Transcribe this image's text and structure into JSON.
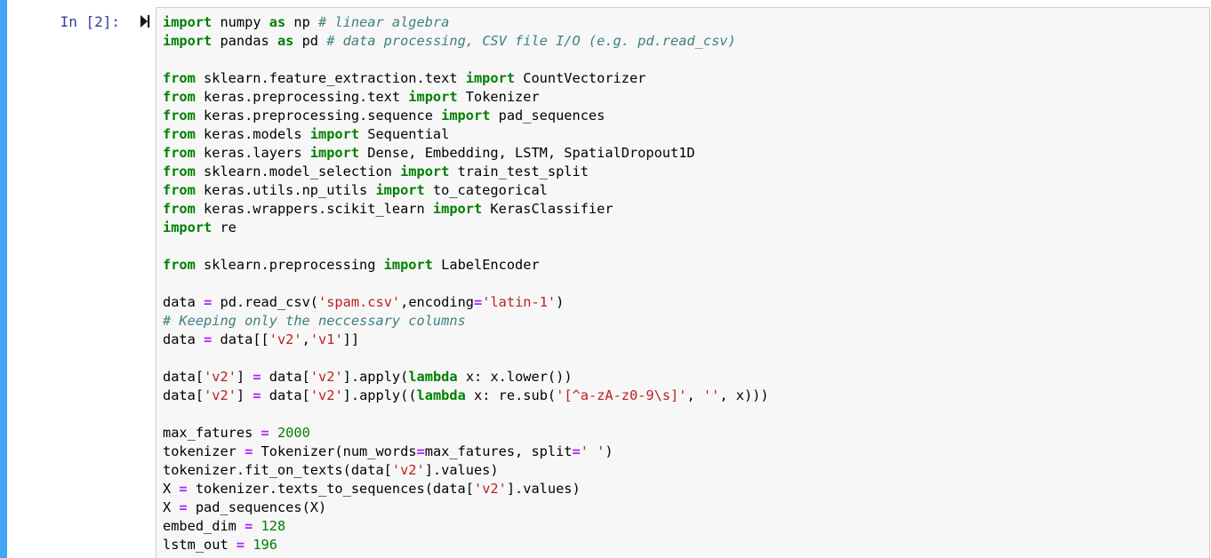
{
  "cell": {
    "prompt": "In [2]:",
    "run_icon": "run-cell-icon"
  },
  "colors": {
    "selected_bar": "#42a5f5",
    "prompt": "#303f9f",
    "keyword": "#008000",
    "comment": "#408080",
    "string": "#ba2121",
    "operator": "#aa22ff",
    "cell_background": "#f7f7f7"
  },
  "code_lines": [
    [
      {
        "t": "kw",
        "v": "import"
      },
      {
        "t": "p",
        "v": " numpy "
      },
      {
        "t": "kw",
        "v": "as"
      },
      {
        "t": "p",
        "v": " np "
      },
      {
        "t": "cm",
        "v": "# linear algebra"
      }
    ],
    [
      {
        "t": "kw",
        "v": "import"
      },
      {
        "t": "p",
        "v": " pandas "
      },
      {
        "t": "kw",
        "v": "as"
      },
      {
        "t": "p",
        "v": " pd "
      },
      {
        "t": "cm",
        "v": "# data processing, CSV file I/O (e.g. pd.read_csv)"
      }
    ],
    [],
    [
      {
        "t": "kw",
        "v": "from"
      },
      {
        "t": "p",
        "v": " sklearn.feature_extraction.text "
      },
      {
        "t": "kw",
        "v": "import"
      },
      {
        "t": "p",
        "v": " CountVectorizer"
      }
    ],
    [
      {
        "t": "kw",
        "v": "from"
      },
      {
        "t": "p",
        "v": " keras.preprocessing.text "
      },
      {
        "t": "kw",
        "v": "import"
      },
      {
        "t": "p",
        "v": " Tokenizer"
      }
    ],
    [
      {
        "t": "kw",
        "v": "from"
      },
      {
        "t": "p",
        "v": " keras.preprocessing.sequence "
      },
      {
        "t": "kw",
        "v": "import"
      },
      {
        "t": "p",
        "v": " pad_sequences"
      }
    ],
    [
      {
        "t": "kw",
        "v": "from"
      },
      {
        "t": "p",
        "v": " keras.models "
      },
      {
        "t": "kw",
        "v": "import"
      },
      {
        "t": "p",
        "v": " Sequential"
      }
    ],
    [
      {
        "t": "kw",
        "v": "from"
      },
      {
        "t": "p",
        "v": " keras.layers "
      },
      {
        "t": "kw",
        "v": "import"
      },
      {
        "t": "p",
        "v": " Dense, Embedding, LSTM, SpatialDropout1D"
      }
    ],
    [
      {
        "t": "kw",
        "v": "from"
      },
      {
        "t": "p",
        "v": " sklearn.model_selection "
      },
      {
        "t": "kw",
        "v": "import"
      },
      {
        "t": "p",
        "v": " train_test_split"
      }
    ],
    [
      {
        "t": "kw",
        "v": "from"
      },
      {
        "t": "p",
        "v": " keras.utils.np_utils "
      },
      {
        "t": "kw",
        "v": "import"
      },
      {
        "t": "p",
        "v": " to_categorical"
      }
    ],
    [
      {
        "t": "kw",
        "v": "from"
      },
      {
        "t": "p",
        "v": " keras.wrappers.scikit_learn "
      },
      {
        "t": "kw",
        "v": "import"
      },
      {
        "t": "p",
        "v": " KerasClassifier"
      }
    ],
    [
      {
        "t": "kw",
        "v": "import"
      },
      {
        "t": "p",
        "v": " re"
      }
    ],
    [],
    [
      {
        "t": "kw",
        "v": "from"
      },
      {
        "t": "p",
        "v": " sklearn.preprocessing "
      },
      {
        "t": "kw",
        "v": "import"
      },
      {
        "t": "p",
        "v": " LabelEncoder"
      }
    ],
    [],
    [
      {
        "t": "p",
        "v": "data "
      },
      {
        "t": "op",
        "v": "="
      },
      {
        "t": "p",
        "v": " pd.read_csv("
      },
      {
        "t": "st",
        "v": "'spam.csv'"
      },
      {
        "t": "p",
        "v": ",encoding"
      },
      {
        "t": "op",
        "v": "="
      },
      {
        "t": "st",
        "v": "'latin-1'"
      },
      {
        "t": "p",
        "v": ")"
      }
    ],
    [
      {
        "t": "cm",
        "v": "# Keeping only the neccessary columns"
      }
    ],
    [
      {
        "t": "p",
        "v": "data "
      },
      {
        "t": "op",
        "v": "="
      },
      {
        "t": "p",
        "v": " data[["
      },
      {
        "t": "st",
        "v": "'v2'"
      },
      {
        "t": "p",
        "v": ","
      },
      {
        "t": "st",
        "v": "'v1'"
      },
      {
        "t": "p",
        "v": "]]"
      }
    ],
    [],
    [
      {
        "t": "p",
        "v": "data["
      },
      {
        "t": "st",
        "v": "'v2'"
      },
      {
        "t": "p",
        "v": "] "
      },
      {
        "t": "op",
        "v": "="
      },
      {
        "t": "p",
        "v": " data["
      },
      {
        "t": "st",
        "v": "'v2'"
      },
      {
        "t": "p",
        "v": "].apply("
      },
      {
        "t": "kw",
        "v": "lambda"
      },
      {
        "t": "p",
        "v": " x: x.lower())"
      }
    ],
    [
      {
        "t": "p",
        "v": "data["
      },
      {
        "t": "st",
        "v": "'v2'"
      },
      {
        "t": "p",
        "v": "] "
      },
      {
        "t": "op",
        "v": "="
      },
      {
        "t": "p",
        "v": " data["
      },
      {
        "t": "st",
        "v": "'v2'"
      },
      {
        "t": "p",
        "v": "].apply(("
      },
      {
        "t": "kw",
        "v": "lambda"
      },
      {
        "t": "p",
        "v": " x: re.sub("
      },
      {
        "t": "st",
        "v": "'[^a-zA-z0-9\\s]'"
      },
      {
        "t": "p",
        "v": ", "
      },
      {
        "t": "st",
        "v": "''"
      },
      {
        "t": "p",
        "v": ", x)))"
      }
    ],
    [],
    [
      {
        "t": "p",
        "v": "max_fatures "
      },
      {
        "t": "op",
        "v": "="
      },
      {
        "t": "p",
        "v": " "
      },
      {
        "t": "nu",
        "v": "2000"
      }
    ],
    [
      {
        "t": "p",
        "v": "tokenizer "
      },
      {
        "t": "op",
        "v": "="
      },
      {
        "t": "p",
        "v": " Tokenizer(num_words"
      },
      {
        "t": "op",
        "v": "="
      },
      {
        "t": "p",
        "v": "max_fatures, split"
      },
      {
        "t": "op",
        "v": "="
      },
      {
        "t": "st",
        "v": "' '"
      },
      {
        "t": "p",
        "v": ")"
      }
    ],
    [
      {
        "t": "p",
        "v": "tokenizer.fit_on_texts(data["
      },
      {
        "t": "st",
        "v": "'v2'"
      },
      {
        "t": "p",
        "v": "].values)"
      }
    ],
    [
      {
        "t": "p",
        "v": "X "
      },
      {
        "t": "op",
        "v": "="
      },
      {
        "t": "p",
        "v": " tokenizer.texts_to_sequences(data["
      },
      {
        "t": "st",
        "v": "'v2'"
      },
      {
        "t": "p",
        "v": "].values)"
      }
    ],
    [
      {
        "t": "p",
        "v": "X "
      },
      {
        "t": "op",
        "v": "="
      },
      {
        "t": "p",
        "v": " pad_sequences(X)"
      }
    ],
    [
      {
        "t": "p",
        "v": "embed_dim "
      },
      {
        "t": "op",
        "v": "="
      },
      {
        "t": "p",
        "v": " "
      },
      {
        "t": "nu",
        "v": "128"
      }
    ],
    [
      {
        "t": "p",
        "v": "lstm_out "
      },
      {
        "t": "op",
        "v": "="
      },
      {
        "t": "p",
        "v": " "
      },
      {
        "t": "nu",
        "v": "196"
      }
    ]
  ]
}
